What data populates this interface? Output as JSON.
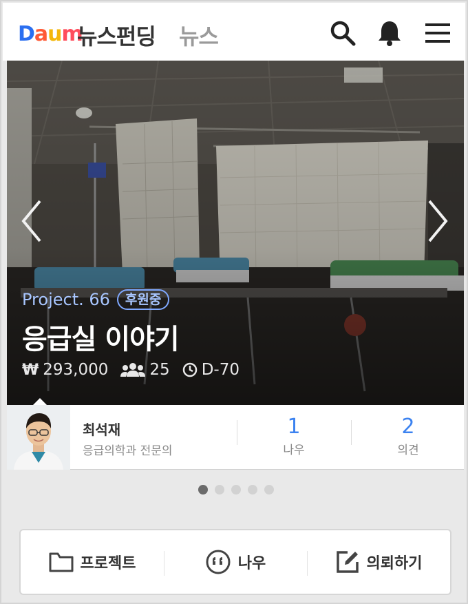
{
  "header": {
    "logo_text": [
      "D",
      "a",
      "u",
      "m"
    ],
    "service_title": "뉴스펀딩",
    "section_title": "뉴스",
    "icons": [
      "search-icon",
      "bell-icon",
      "hamburger-menu-icon"
    ]
  },
  "hero": {
    "project_number": "Project. 66",
    "status_badge": "후원중",
    "title": "응급실 이야기",
    "amount": "293,000",
    "currency_symbol": "₩",
    "supporters": "25",
    "days_left": "D-70"
  },
  "author": {
    "name": "최석재",
    "role": "응급의학과 전문의",
    "metrics": [
      {
        "value": "1",
        "label": "나우"
      },
      {
        "value": "2",
        "label": "의견"
      }
    ]
  },
  "carousel": {
    "total": 5,
    "active_index": 0
  },
  "actions": [
    {
      "label": "프로젝트",
      "icon": "folder-icon"
    },
    {
      "label": "나우",
      "icon": "quote-bubble-icon"
    },
    {
      "label": "의뢰하기",
      "icon": "edit-icon"
    }
  ],
  "colors": {
    "accent_blue": "#3b82f0",
    "badge_blue": "#a8c6ff",
    "frame_gray": "#e9e9e9"
  }
}
